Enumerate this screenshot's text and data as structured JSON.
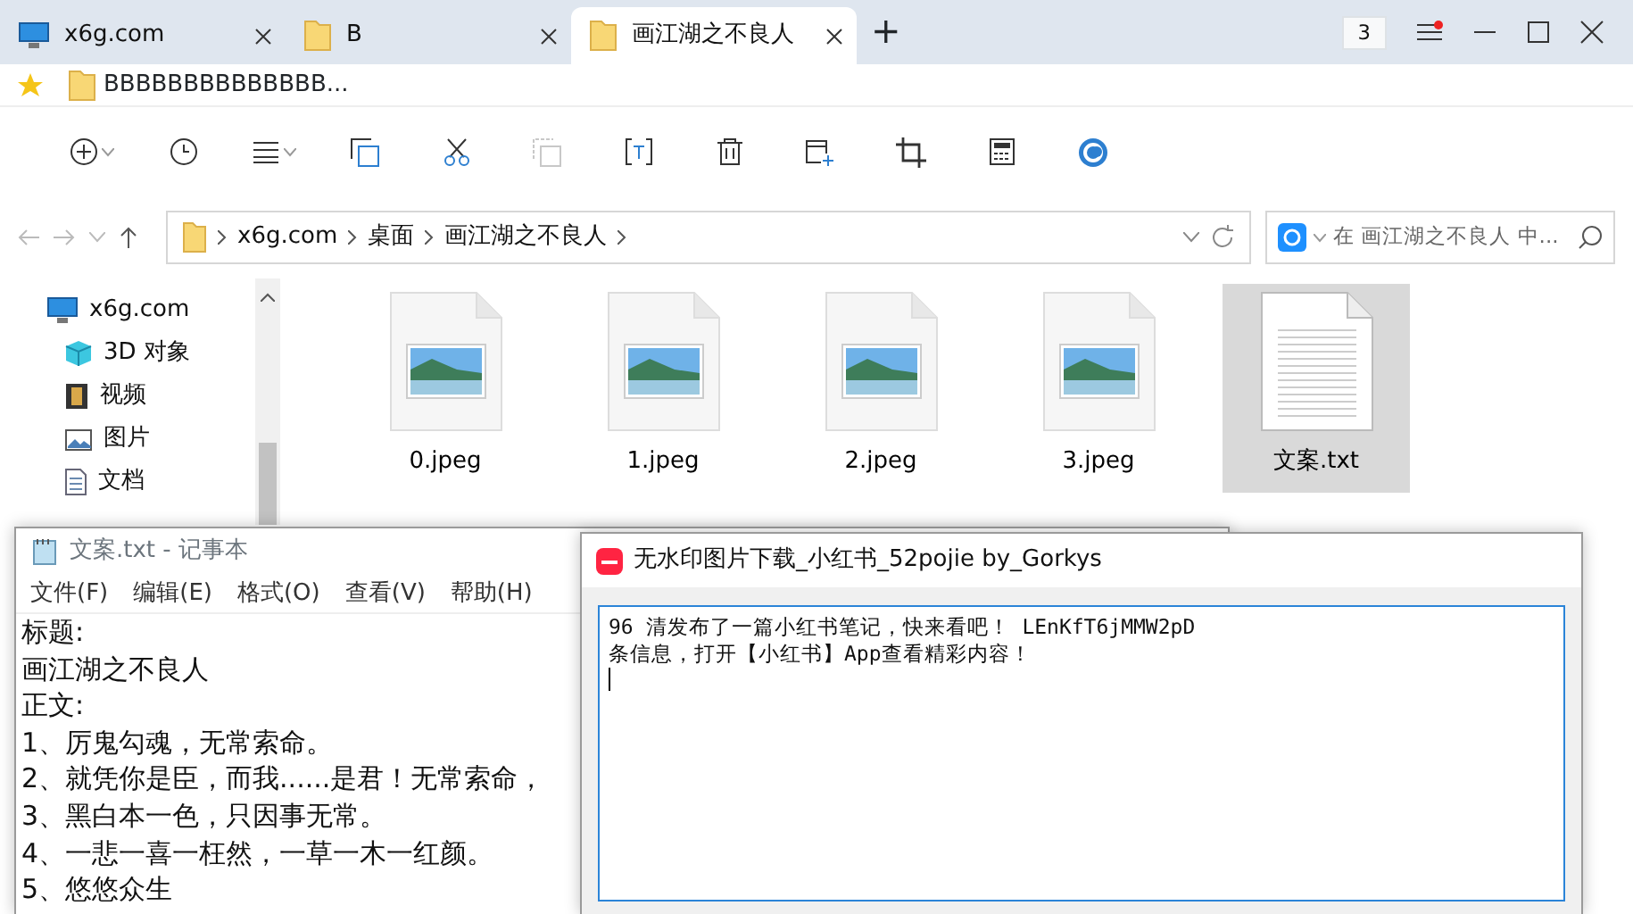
{
  "tabs": [
    {
      "label": "x6g.com",
      "kind": "computer",
      "selected": false
    },
    {
      "label": "B",
      "kind": "folder",
      "selected": false
    },
    {
      "label": "画江湖之不良人",
      "kind": "folder",
      "selected": true
    }
  ],
  "new_tab": "+",
  "tab_count": "3",
  "favorites": [
    {
      "label": "BBBBBBBBBBBBBB...",
      "kind": "folder"
    }
  ],
  "toolbar": [
    {
      "kind": "add",
      "dropdown": true,
      "disabled": false
    },
    {
      "kind": "history",
      "dropdown": false,
      "disabled": false
    },
    {
      "kind": "view",
      "dropdown": true,
      "disabled": false
    },
    {
      "kind": "copy",
      "dropdown": false,
      "disabled": false
    },
    {
      "kind": "cut",
      "dropdown": false,
      "disabled": false
    },
    {
      "kind": "copy",
      "dropdown": false,
      "disabled": true
    },
    {
      "kind": "rename",
      "dropdown": false,
      "disabled": false
    },
    {
      "kind": "delete",
      "dropdown": false,
      "disabled": false
    },
    {
      "kind": "newwin",
      "dropdown": false,
      "disabled": false
    },
    {
      "kind": "crop",
      "dropdown": false,
      "disabled": false
    },
    {
      "kind": "calc",
      "dropdown": false,
      "disabled": false
    },
    {
      "kind": "app",
      "dropdown": false,
      "disabled": false
    }
  ],
  "address": {
    "path": [
      "x6g.com",
      "桌面",
      "画江湖之不良人"
    ]
  },
  "search": {
    "placeholder": "在 画江湖之不良人 中..."
  },
  "sidebar": {
    "items": [
      {
        "label": "x6g.com",
        "kind": "computer",
        "children": [
          {
            "label": "3D 对象",
            "kind": "cube"
          },
          {
            "label": "视频",
            "kind": "film"
          },
          {
            "label": "图片",
            "kind": "picture"
          },
          {
            "label": "文档",
            "kind": "document"
          }
        ]
      }
    ]
  },
  "files": [
    {
      "name": "0.jpeg",
      "kind": "image",
      "selected": false
    },
    {
      "name": "1.jpeg",
      "kind": "image",
      "selected": false
    },
    {
      "name": "2.jpeg",
      "kind": "image",
      "selected": false
    },
    {
      "name": "3.jpeg",
      "kind": "image",
      "selected": false
    },
    {
      "name": "文案.txt",
      "kind": "text",
      "selected": true
    }
  ],
  "notepad": {
    "title": "文案.txt - 记事本",
    "menu": [
      "文件(F)",
      "编辑(E)",
      "格式(O)",
      "查看(V)",
      "帮助(H)"
    ],
    "lines": [
      "标题:",
      "画江湖之不良人",
      "正文:",
      "1、厉鬼勾魂，无常索命。",
      "2、就凭你是臣，而我......是君！无常索命，",
      "3、黑白本一色，只因事无常。",
      "4、一悲一喜一枉然，一草一木一红颜。",
      "5、悠悠众生"
    ]
  },
  "app": {
    "title": "无水印图片下载_小红书_52pojie  by_Gorkys",
    "lines": [
      "96 清发布了一篇小红书笔记，快来看吧！   LEnKfT6jMMW2pD",
      "条信息，打开【小红书】App查看精彩内容！"
    ]
  }
}
